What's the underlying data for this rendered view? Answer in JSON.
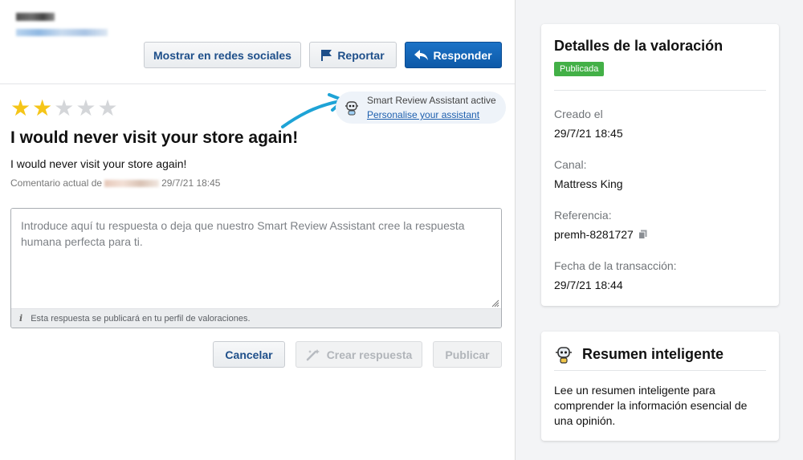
{
  "header": {
    "buttons": {
      "share": "Mostrar en redes sociales",
      "report": "Reportar",
      "reply": "Responder"
    }
  },
  "review": {
    "rating": 2,
    "max_rating": 5,
    "title": "I would never visit your store again!",
    "body": "I would never visit your store again!",
    "meta_prefix": "Comentario actual de",
    "date": "29/7/21 18:45"
  },
  "assistant": {
    "status": "Smart Review Assistant active",
    "link": "Personalise your assistant"
  },
  "reply": {
    "placeholder": "Introduce aquí tu respuesta o deja que nuestro Smart Review Assistant cree la respuesta humana perfecta para ti.",
    "info_icon": "i",
    "footer_note": "Esta respuesta se publicará en tu perfil de valoraciones.",
    "cancel": "Cancelar",
    "create": "Crear respuesta",
    "publish": "Publicar"
  },
  "details": {
    "title": "Detalles de la valoración",
    "status": "Publicada",
    "status_color": "#43b047",
    "fields": [
      {
        "label": "Creado el",
        "value": "29/7/21 18:45"
      },
      {
        "label": "Canal:",
        "value": "Mattress King"
      },
      {
        "label": "Referencia:",
        "value": "premh-8281727"
      },
      {
        "label": "Fecha de la transacción:",
        "value": "29/7/21 18:44"
      }
    ]
  },
  "summary": {
    "title": "Resumen inteligente",
    "text": "Lee un resumen inteligente para comprender la información esencial de una opinión."
  },
  "colors": {
    "primary": "#0d59a8",
    "star": "#f5c518",
    "link": "#1d5fae",
    "arrow": "#1ea3d6"
  }
}
